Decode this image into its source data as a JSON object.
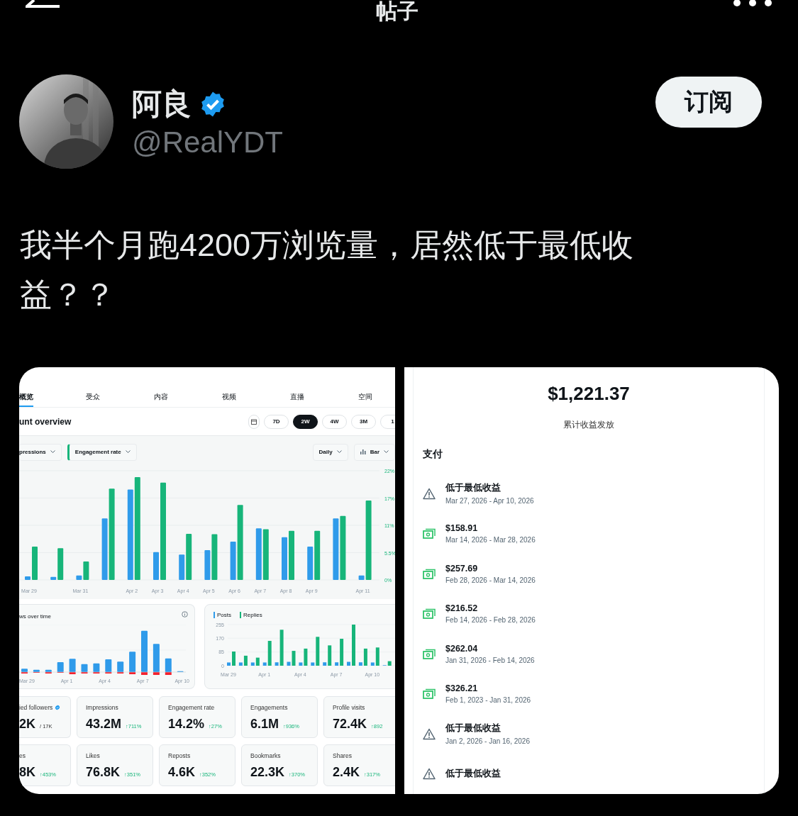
{
  "header": {
    "title": "帖子"
  },
  "author": {
    "name": "阿良",
    "verified": true,
    "handle": "@RealYDT",
    "subscribe_label": "订阅"
  },
  "post_text": "我半个月跑4200万浏览量，居然低于最低收益？？",
  "analytics_screenshot": {
    "tabs": [
      {
        "label": "概览",
        "selected": true
      },
      {
        "label": "受众",
        "selected": false
      },
      {
        "label": "内容",
        "selected": false
      },
      {
        "label": "视频",
        "selected": false
      },
      {
        "label": "直播",
        "selected": false
      },
      {
        "label": "空间",
        "selected": false
      }
    ],
    "overview_title": "unt overview",
    "ranges": [
      {
        "label": "7D",
        "selected": false
      },
      {
        "label": "2W",
        "selected": true
      },
      {
        "label": "4W",
        "selected": false
      },
      {
        "label": "3M",
        "selected": false
      },
      {
        "label": "1",
        "selected": false
      }
    ],
    "view_options": [
      {
        "label": "Daily",
        "kind": "interval"
      },
      {
        "label": "Bar",
        "kind": "chart-type"
      }
    ],
    "main_chart": {
      "chart_data": {
        "type": "bar",
        "stacked": false,
        "grid": true,
        "categories": [
          "Mar 29",
          null,
          "Mar 31",
          null,
          "Apr 2",
          "Apr 3",
          "Apr 4",
          "Apr 5",
          "Apr 6",
          "Apr 7",
          "Apr 8",
          "Apr 9",
          null,
          "Apr 11"
        ],
        "yticks": [
          {
            "value": 0,
            "label": "0%"
          },
          {
            "value": 5.5,
            "label": "5.5%"
          },
          {
            "value": 11,
            "label": "11%"
          },
          {
            "value": 16.5,
            "label": "17%"
          },
          {
            "value": 22,
            "label": "22%"
          }
        ],
        "ylim": [
          0,
          22
        ],
        "series": [
          {
            "name": "pressions",
            "color": "#2f9bea",
            "values": [
              0.7,
              0.6,
              0.9,
              12.4,
              18.2,
              5.6,
              5.1,
              6.0,
              7.7,
              10.4,
              8.6,
              6.7,
              12.4,
              0.9
            ]
          },
          {
            "name": "Engagement rate",
            "color": "#17b57a",
            "values": [
              6.7,
              6.4,
              3.7,
              18.4,
              20.7,
              19.6,
              9.3,
              9.2,
              15.1,
              10.2,
              9.9,
              9.9,
              12.9,
              16.0
            ]
          }
        ]
      }
    },
    "views_card": {
      "title": "ws over time",
      "x_labels": [
        "Mar 29",
        "Apr 1",
        "Apr 4",
        "Apr 7",
        "Apr 10"
      ]
    },
    "posts_card": {
      "chart_data": {
        "type": "bar",
        "stacked": false,
        "grid": true,
        "categories": [
          "Mar 29",
          null,
          null,
          "Apr 1",
          null,
          null,
          "Apr 4",
          null,
          null,
          "Apr 7",
          null,
          null,
          "Apr 10",
          null
        ],
        "yticks": [
          0,
          85,
          170,
          255
        ],
        "ylim": [
          0,
          255
        ],
        "series": [
          {
            "name": "Posts",
            "color": "#2f9bea",
            "values": [
              20,
              20,
              20,
              20,
              21,
              24,
              20,
              20,
              21,
              21,
              24,
              21,
              20,
              3
            ]
          },
          {
            "name": "Replies",
            "color": "#17b57a",
            "values": [
              88,
              62,
              50,
              154,
              223,
              92,
              106,
              179,
              126,
              167,
              255,
              106,
              113,
              28
            ]
          }
        ]
      }
    },
    "metric_rows": [
      [
        {
          "label": "ied followers",
          "verified": true,
          "value": "2K",
          "total": "/ 17K"
        },
        {
          "label": "Impressions",
          "value": "43.2M",
          "change": "↑711%"
        },
        {
          "label": "Engagement rate",
          "value": "14.2%",
          "change": "↑27%"
        },
        {
          "label": "Engagements",
          "value": "6.1M",
          "change": "↑936%"
        },
        {
          "label": "Profile visits",
          "value": "72.4K",
          "change": "↑892"
        }
      ],
      [
        {
          "label": "es",
          "value": "8K",
          "change": "↑453%"
        },
        {
          "label": "Likes",
          "value": "76.8K",
          "change": "↑351%"
        },
        {
          "label": "Reposts",
          "value": "4.6K",
          "change": "↑352%"
        },
        {
          "label": "Bookmarks",
          "value": "22.3K",
          "change": "↑370%"
        },
        {
          "label": "Shares",
          "value": "2.4K",
          "change": "↑317%"
        }
      ]
    ]
  },
  "revenue_screenshot": {
    "total": "$1,221.37",
    "total_label": "累计收益发放",
    "section_title": "支付",
    "payouts": [
      {
        "kind": "warning",
        "title": "低于最低收益",
        "dates": "Mar 27, 2026 - Apr 10, 2026"
      },
      {
        "kind": "payment",
        "title": "$158.91",
        "dates": "Mar 14, 2026 - Mar 28, 2026"
      },
      {
        "kind": "payment",
        "title": "$257.69",
        "dates": "Feb 28, 2026 - Mar 14, 2026"
      },
      {
        "kind": "payment",
        "title": "$216.52",
        "dates": "Feb 14, 2026 - Feb 28, 2026"
      },
      {
        "kind": "payment",
        "title": "$262.04",
        "dates": "Jan 31, 2026 - Feb 14, 2026"
      },
      {
        "kind": "payment",
        "title": "$326.21",
        "dates": "Feb 1, 2023 - Jan 31, 2026"
      },
      {
        "kind": "warning",
        "title": "低于最低收益",
        "dates": "Jan 2, 2026 - Jan 16, 2026"
      },
      {
        "kind": "warning",
        "title": "低于最低收益"
      }
    ]
  }
}
